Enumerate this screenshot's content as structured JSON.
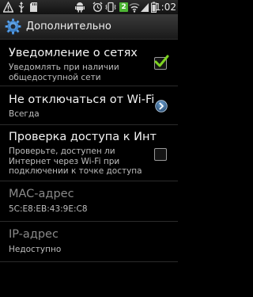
{
  "status_bar": {
    "time": "1:02",
    "notification_badge": "2",
    "icons": [
      "warning-icon",
      "usb-icon",
      "sd-card-icon",
      "android-icon",
      "alarm-icon",
      "vibrate-icon",
      "wifi-icon",
      "signal-icon",
      "battery-icon"
    ]
  },
  "title_bar": {
    "title": "Дополнительно",
    "icon": "gear-icon"
  },
  "settings": [
    {
      "title": "Уведомление о сетях",
      "subtitle": "Уведомлять при наличии\nобщедоступной сети",
      "control": "checkbox",
      "checked": true,
      "enabled": true
    },
    {
      "title": "Не отключаться от Wi-Fi",
      "subtitle": "Всегда",
      "control": "chevron",
      "enabled": true
    },
    {
      "title": "Проверка доступа к Инт",
      "subtitle": "Проверьте, доступен ли\nИнтернет через Wi-Fi при\nподключении к точке доступа",
      "control": "checkbox",
      "checked": false,
      "enabled": true
    },
    {
      "title": "MAC-адрес",
      "subtitle": "5C:E8:EB:43:9E:C8",
      "control": "none",
      "enabled": false
    },
    {
      "title": "IP-адрес",
      "subtitle": "Недоступно",
      "control": "none",
      "enabled": false
    }
  ],
  "colors": {
    "accent_check": "#7ed321",
    "badge_green": "#4db534",
    "background": "#000000"
  }
}
